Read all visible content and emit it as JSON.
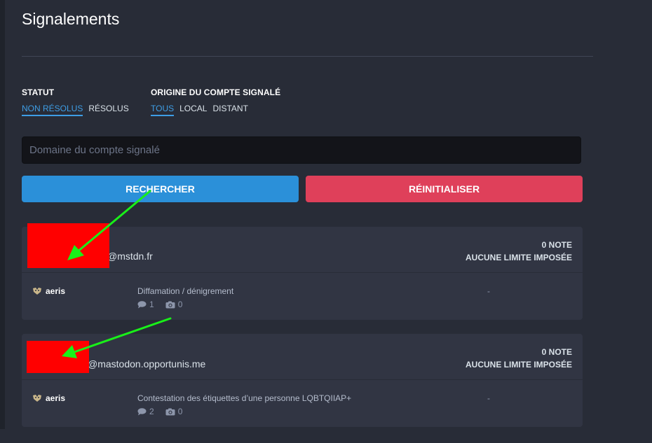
{
  "page": {
    "title": "Signalements"
  },
  "filters": {
    "status": {
      "heading": "STATUT",
      "options": [
        "NON RÉSOLUS",
        "RÉSOLUS"
      ],
      "selected": "NON RÉSOLUS"
    },
    "origin": {
      "heading": "ORIGINE DU COMPTE SIGNALÉ",
      "options": [
        "TOUS",
        "LOCAL",
        "DISTANT"
      ],
      "selected": "TOUS"
    }
  },
  "search": {
    "placeholder": "Domaine du compte signalé",
    "value": ""
  },
  "buttons": {
    "search": "RECHERCHER",
    "reset": "RÉINITIALISER"
  },
  "reports": [
    {
      "account": "@mstdn.fr",
      "notes": "0 NOTE",
      "limit": "AUCUNE LIMITE IMPOSÉE",
      "reporter": "aeris",
      "category": "Diffamation / dénigrement",
      "comments": "1",
      "media": "0",
      "action": "-"
    },
    {
      "account": "@mastodon.opportunis.me",
      "notes": "0 NOTE",
      "limit": "AUCUNE LIMITE IMPOSÉE",
      "reporter": "aeris",
      "category": "Contestation des étiquettes d’une personne LQBTQIIAP+",
      "comments": "2",
      "media": "0",
      "action": "-"
    }
  ],
  "colors": {
    "background": "#282c37",
    "card": "#313543",
    "accent": "#3e9ee6",
    "search_button": "#2b90d9",
    "reset_button": "#df405a",
    "redaction": "#ff0000",
    "annotation_arrow": "#19f019"
  },
  "icons": {
    "comment": "comment-icon",
    "media": "camera-icon",
    "reporter_avatar": "avatar-icon"
  }
}
